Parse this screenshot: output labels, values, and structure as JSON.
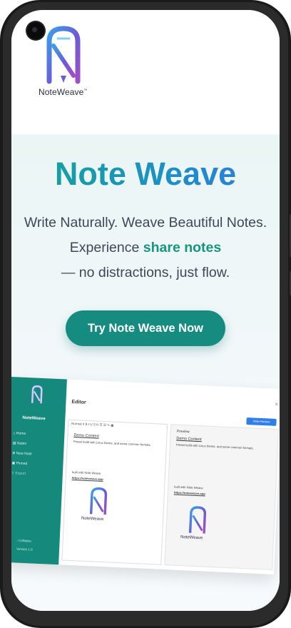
{
  "brand": {
    "logo_text": "NoteWeave",
    "trademark": "™"
  },
  "hero": {
    "title": "Note Weave",
    "line1": "Write Naturally. Weave Beautiful Notes.",
    "line2_prefix": "Experience ",
    "line2_highlight": "share notes",
    "line3": "— no distractions, just flow.",
    "cta_label": "Try Note Weave Now"
  },
  "app_preview": {
    "sidebar_brand": "NoteWeave",
    "nav": [
      "Home",
      "Notes",
      "New Note",
      "Pinned",
      "Export"
    ],
    "collapse": "Collapse",
    "version": "Version 1.0",
    "editor_title": "Editor",
    "hide_preview": "Hide Preview",
    "toolbar": "Normal  ¢   B  I  U  S  H   ☰  ☰   ✎  ▣",
    "demo_title": "Demo Content",
    "demo_body": "Preset build with Linux theme, and some common formats.",
    "built_with": "built with Note Weave",
    "link": "https://noteweave.app",
    "preview_label": "Preview",
    "logo_text": "NoteWeave"
  },
  "colors": {
    "accent": "#168c80",
    "title_gradient_start": "#12a594",
    "title_gradient_end": "#2f79e0",
    "highlight": "#14967f"
  }
}
